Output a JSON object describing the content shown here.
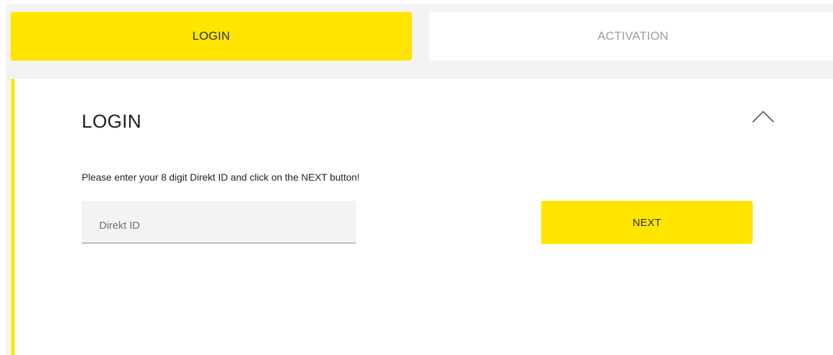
{
  "tabs": [
    {
      "label": "LOGIN",
      "active": true
    },
    {
      "label": "ACTIVATION",
      "active": false
    }
  ],
  "login_panel": {
    "title": "LOGIN",
    "collapse_icon": "chevron-up-icon",
    "instruction": "Please enter your 8 digit Direkt ID and click on the NEXT button!",
    "direkt_id_field": {
      "placeholder": "Direkt ID",
      "value": ""
    },
    "next_button_label": "NEXT"
  },
  "colors": {
    "accent": "#ffe500",
    "background": "#f3f3f3",
    "inactive_tab_text": "#9c9c9c"
  }
}
